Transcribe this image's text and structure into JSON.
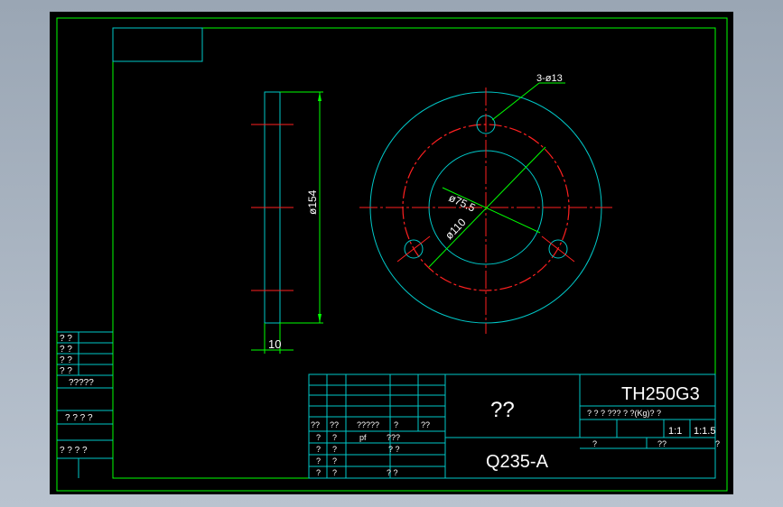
{
  "colors": {
    "frame": "#00ff00",
    "outline": "#00c8c8",
    "center": "#ff2020",
    "text": "#ffffff",
    "background": "#000000"
  },
  "dimensions": {
    "holes": "3-ø13",
    "inner": "ø75.5",
    "bolt_circle": "ø110",
    "height": "ø154",
    "thickness": "10"
  },
  "title_block": {
    "part_name": "??",
    "drawing_number": "TH250G3",
    "material": "Q235-A",
    "scale_a": "1:1",
    "scale_b": "1:1.5",
    "weight_row": "?  ?  ?  ??? ? ?(Kg)?  ?",
    "bottom_left": "?",
    "bottom_mid": "??",
    "bottom_right": "?"
  },
  "revision_table": {
    "row1": [
      "??",
      "??",
      "?????",
      "?",
      "??"
    ],
    "row2": [
      "?",
      "?",
      "pf",
      "???"
    ],
    "row3": [
      "?",
      "?",
      "? ?"
    ],
    "row4": [
      "?",
      "?"
    ],
    "row5": [
      "?",
      "?",
      "? ?"
    ]
  },
  "left_side": {
    "rows": [
      "? ?",
      "? ?",
      "? ?",
      "? ?"
    ],
    "label1": "?????",
    "label2": "? ? ? ?",
    "label3": "? ? ?  ?"
  }
}
